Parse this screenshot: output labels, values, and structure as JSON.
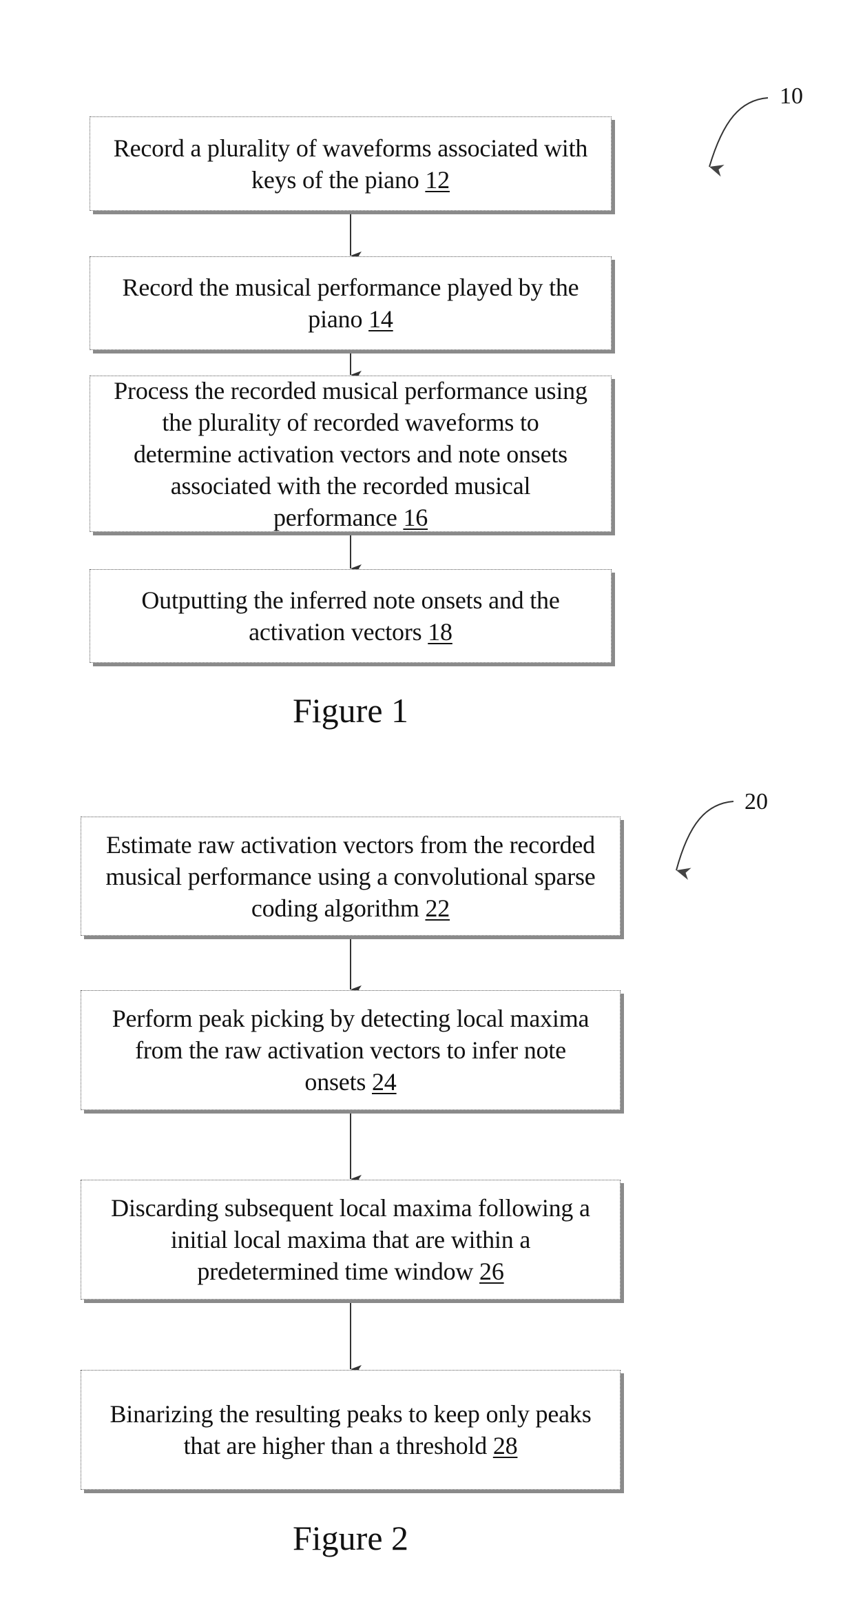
{
  "figures": [
    {
      "label": "Figure 1",
      "reference_number": "10",
      "steps": [
        {
          "lines": [
            "Record a plurality of waveforms associated with",
            "keys of the piano "
          ],
          "ref": "12"
        },
        {
          "lines": [
            "Record the musical performance played by the",
            "piano "
          ],
          "ref": "14"
        },
        {
          "lines": [
            "Process the recorded musical performance using",
            "the plurality of recorded waveforms to",
            "determine activation vectors and note onsets",
            "associated with the recorded musical",
            "performance "
          ],
          "ref": "16"
        },
        {
          "lines": [
            "Outputting the inferred note onsets and the",
            "activation vectors "
          ],
          "ref": "18"
        }
      ]
    },
    {
      "label": "Figure 2",
      "reference_number": "20",
      "steps": [
        {
          "lines": [
            "Estimate raw activation vectors from the recorded",
            "musical performance using a convolutional sparse",
            "coding algorithm "
          ],
          "ref": "22"
        },
        {
          "lines": [
            "Perform peak picking by detecting local maxima",
            "from the raw activation vectors to infer note",
            "onsets "
          ],
          "ref": "24"
        },
        {
          "lines": [
            "Discarding subsequent local maxima following a",
            "initial local maxima that are within a",
            "predetermined time window "
          ],
          "ref": "26"
        },
        {
          "lines": [
            "Binarizing the resulting peaks to keep only peaks",
            "that are higher than a threshold "
          ],
          "ref": "28"
        }
      ]
    }
  ],
  "colors": {
    "text": "#111111",
    "box_border": "#555555",
    "shadow": "#8a8a8a",
    "arrow": "#333333"
  }
}
